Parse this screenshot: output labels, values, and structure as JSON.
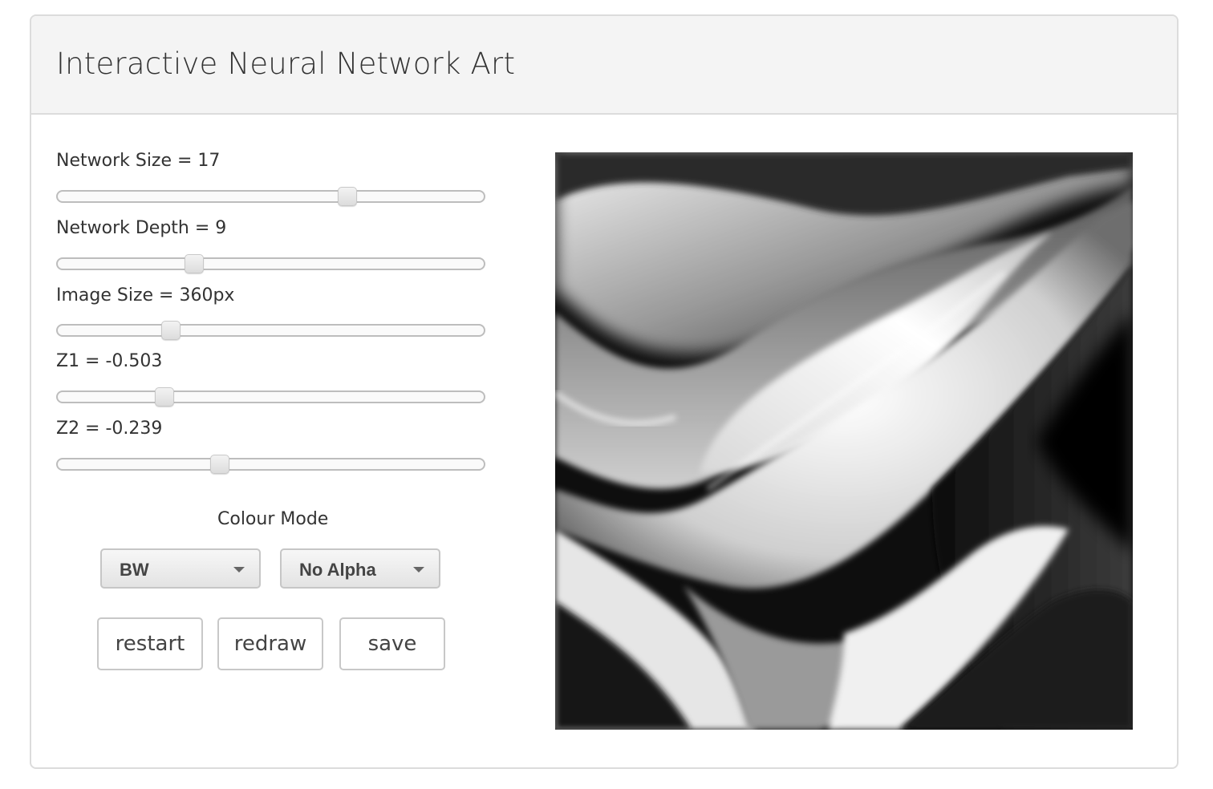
{
  "header": {
    "title": "Interactive Neural Network Art"
  },
  "sliders": [
    {
      "label": "Network Size = 17",
      "value": 0.68
    },
    {
      "label": "Network Depth = 9",
      "value": 0.32
    },
    {
      "label": "Image Size = 360px",
      "value": 0.265
    },
    {
      "label": "Z1 = -0.503",
      "value": 0.25
    },
    {
      "label": "Z2 = -0.239",
      "value": 0.38
    }
  ],
  "colour_mode": {
    "label": "Colour Mode",
    "mode_select": "BW",
    "alpha_select": "No Alpha"
  },
  "buttons": {
    "restart": "restart",
    "redraw": "redraw",
    "save": "save"
  },
  "artwork": {
    "palette": [
      "#0a0a0a",
      "#ffffff"
    ]
  }
}
